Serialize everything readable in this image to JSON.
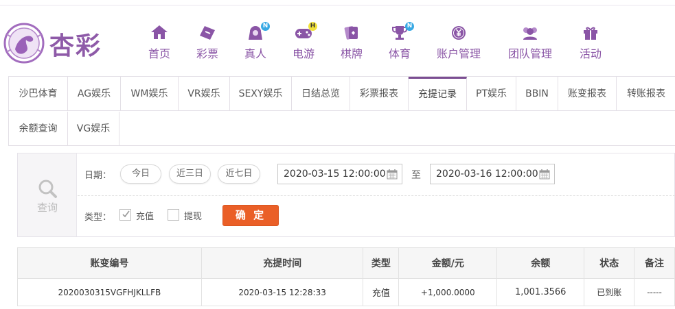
{
  "brand": {
    "name": "杏彩",
    "color": "#8e5aa8"
  },
  "nav": [
    {
      "label": "首页",
      "icon": "home-icon"
    },
    {
      "label": "彩票",
      "icon": "lottery-ticket-icon"
    },
    {
      "label": "真人",
      "icon": "live-dealer-icon",
      "badge": "N"
    },
    {
      "label": "电游",
      "icon": "gamepad-icon",
      "badge": "H"
    },
    {
      "label": "棋牌",
      "icon": "cards-icon"
    },
    {
      "label": "体育",
      "icon": "trophy-icon",
      "badge": "N"
    },
    {
      "label": "账户管理",
      "icon": "yuan-coin-icon"
    },
    {
      "label": "团队管理",
      "icon": "team-icon"
    },
    {
      "label": "活动",
      "icon": "gift-icon"
    }
  ],
  "tabs": [
    "沙巴体育",
    "AG娱乐",
    "WM娱乐",
    "VR娱乐",
    "SEXY娱乐",
    "日结总览",
    "彩票报表",
    "充提记录",
    "PT娱乐",
    "BBIN",
    "账变报表",
    "转账报表",
    "余额查询",
    "VG娱乐"
  ],
  "active_tab": "充提记录",
  "filter": {
    "side_label": "查询",
    "date_label": "日期：",
    "quick_ranges": [
      "今日",
      "近三日",
      "近七日"
    ],
    "start_datetime": "2020-03-15 12:00:00",
    "to_label": "至",
    "end_datetime": "2020-03-16 12:00:00",
    "type_label": "类型：",
    "types": [
      {
        "label": "充值",
        "checked": true
      },
      {
        "label": "提现",
        "checked": false
      }
    ],
    "confirm_label": "确 定"
  },
  "table": {
    "columns": [
      "账变编号",
      "充提时间",
      "类型",
      "金额/元",
      "余额",
      "状态",
      "备注"
    ],
    "rows": [
      [
        "2020030315VGFHJKLLFB",
        "2020-03-15 12:28:33",
        "充值",
        "+1,000.0000",
        "1,001.3566",
        "已到账",
        "-----"
      ]
    ]
  },
  "colors": {
    "accent": "#8a55a6",
    "confirm": "#ea5f27",
    "amount": "#d7131d",
    "status_ok": "#2fa427"
  }
}
